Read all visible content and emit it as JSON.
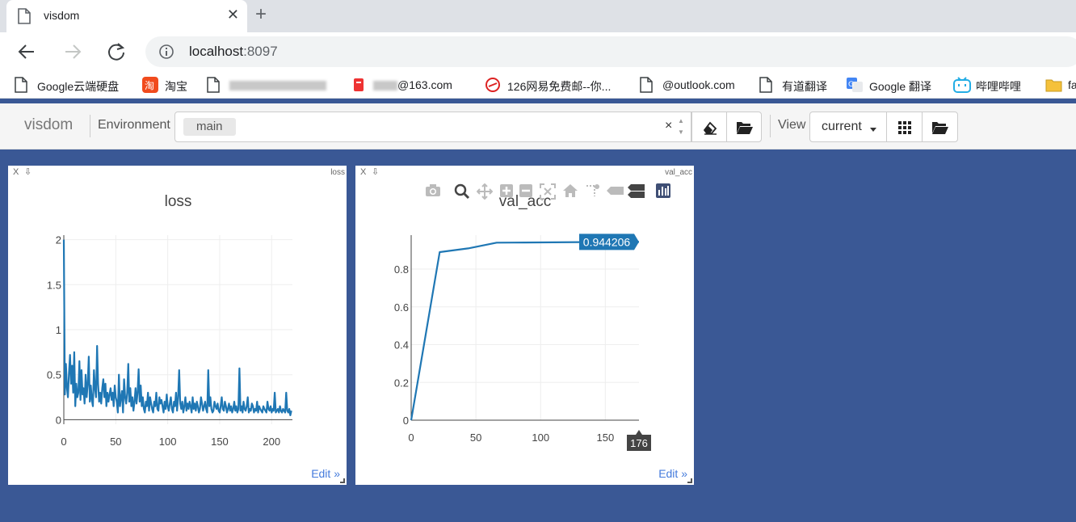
{
  "browser": {
    "tab_title": "visdom",
    "tab_close": "✕",
    "new_tab": "+",
    "url_host": "localhost",
    "url_port": ":8097"
  },
  "bookmarks": [
    {
      "label": "Google云端硬盘",
      "icon": "file-icon"
    },
    {
      "label": "淘宝",
      "icon": "taobao-icon"
    },
    {
      "label": "",
      "icon": "file-icon"
    },
    {
      "label": "@163.com",
      "icon": "mail-163-icon"
    },
    {
      "label": "126网易免费邮--你...",
      "icon": "mail-126-icon"
    },
    {
      "label": "@outlook.com",
      "icon": "file-icon"
    },
    {
      "label": "有道翻译",
      "icon": "file-icon"
    },
    {
      "label": "Google 翻译",
      "icon": "google-translate-icon"
    },
    {
      "label": "哔哩哔哩",
      "icon": "bilibili-icon"
    },
    {
      "label": "fa",
      "icon": "folder-icon"
    }
  ],
  "visdom": {
    "brand": "visdom",
    "env_label": "Environment",
    "env_selected": "main",
    "env_clear": "×",
    "view_label": "View",
    "view_selected": "current"
  },
  "panes": [
    {
      "name": "loss",
      "close": "X",
      "edit": "Edit »",
      "chart_data": {
        "type": "line",
        "title": "loss",
        "xlim": [
          0,
          220
        ],
        "ylim": [
          -0.05,
          2.05
        ],
        "xticks": [
          0,
          50,
          100,
          150,
          200
        ],
        "yticks": [
          0,
          0.5,
          1,
          1.5,
          2
        ],
        "ytick_labels": [
          "0",
          "0.5",
          "1",
          "1.5",
          "2"
        ],
        "color": "#1f77b4",
        "x_start": 0,
        "values": [
          2.0,
          0.28,
          0.62,
          0.35,
          0.25,
          0.52,
          0.72,
          0.4,
          0.6,
          0.3,
          0.75,
          0.15,
          0.4,
          0.25,
          0.3,
          0.65,
          0.22,
          0.55,
          0.28,
          0.35,
          0.18,
          0.5,
          0.25,
          0.4,
          0.7,
          0.2,
          0.38,
          0.22,
          0.15,
          0.55,
          0.35,
          0.25,
          0.82,
          0.4,
          0.2,
          0.3,
          0.18,
          0.35,
          0.45,
          0.25,
          0.4,
          0.15,
          0.3,
          0.2,
          0.28,
          0.35,
          0.22,
          0.3,
          0.15,
          0.38,
          0.25,
          0.2,
          0.08,
          0.5,
          0.15,
          0.25,
          0.32,
          0.08,
          0.45,
          0.25,
          0.18,
          0.3,
          0.62,
          0.2,
          0.35,
          0.15,
          0.25,
          0.1,
          0.2,
          0.35,
          0.18,
          0.3,
          0.56,
          0.2,
          0.38,
          0.15,
          0.25,
          0.12,
          0.08,
          0.2,
          0.15,
          0.3,
          0.1,
          0.25,
          0.18,
          0.12,
          0.08,
          0.2,
          0.15,
          0.3,
          0.12,
          0.1,
          0.25,
          0.18,
          0.22,
          0.15,
          0.08,
          0.2,
          0.12,
          0.28,
          0.15,
          0.1,
          0.18,
          0.25,
          0.12,
          0.08,
          0.2,
          0.15,
          0.3,
          0.1,
          0.25,
          0.55,
          0.18,
          0.12,
          0.2,
          0.08,
          0.15,
          0.25,
          0.1,
          0.18,
          0.12,
          0.2,
          0.15,
          0.08,
          0.25,
          0.12,
          0.18,
          0.1,
          0.2,
          0.15,
          0.08,
          0.12,
          0.25,
          0.18,
          0.1,
          0.15,
          0.2,
          0.12,
          0.08,
          0.55,
          0.15,
          0.25,
          0.12,
          0.08,
          0.1,
          0.2,
          0.15,
          0.12,
          0.18,
          0.1,
          0.08,
          0.15,
          0.25,
          0.12,
          0.1,
          0.2,
          0.15,
          0.08,
          0.12,
          0.18,
          0.1,
          0.15,
          0.08,
          0.12,
          0.2,
          0.1,
          0.15,
          0.08,
          0.12,
          0.57,
          0.1,
          0.15,
          0.08,
          0.2,
          0.12,
          0.1,
          0.15,
          0.25,
          0.08,
          0.12,
          0.1,
          0.18,
          0.15,
          0.08,
          0.12,
          0.1,
          0.2,
          0.08,
          0.15,
          0.12,
          0.1,
          0.08,
          0.15,
          0.12,
          0.1,
          0.08,
          0.2,
          0.12,
          0.1,
          0.15,
          0.08,
          0.12,
          0.1,
          0.3,
          0.08,
          0.1,
          0.12,
          0.08,
          0.15,
          0.1,
          0.08,
          0.12,
          0.1,
          0.08,
          0.3,
          0.1,
          0.08,
          0.12,
          0.05,
          0.1
        ]
      }
    },
    {
      "name": "val_acc",
      "close": "X",
      "edit": "Edit »",
      "chart_data": {
        "type": "line",
        "title": "val_acc",
        "xlim": [
          0,
          176
        ],
        "ylim": [
          0,
          0.98
        ],
        "xticks": [
          0,
          50,
          100,
          150
        ],
        "yticks": [
          0,
          0.2,
          0.4,
          0.6,
          0.8
        ],
        "ytick_labels": [
          "0",
          "0.2",
          "0.4",
          "0.6",
          "0.8"
        ],
        "color": "#1f77b4",
        "x": [
          0,
          22,
          44,
          66,
          88,
          110,
          132,
          154,
          176
        ],
        "y": [
          0,
          0.89,
          0.91,
          0.94,
          0.941,
          0.942,
          0.943,
          0.9435,
          0.944206
        ],
        "hover_value": "0.944206",
        "hover_x": "176"
      }
    }
  ]
}
